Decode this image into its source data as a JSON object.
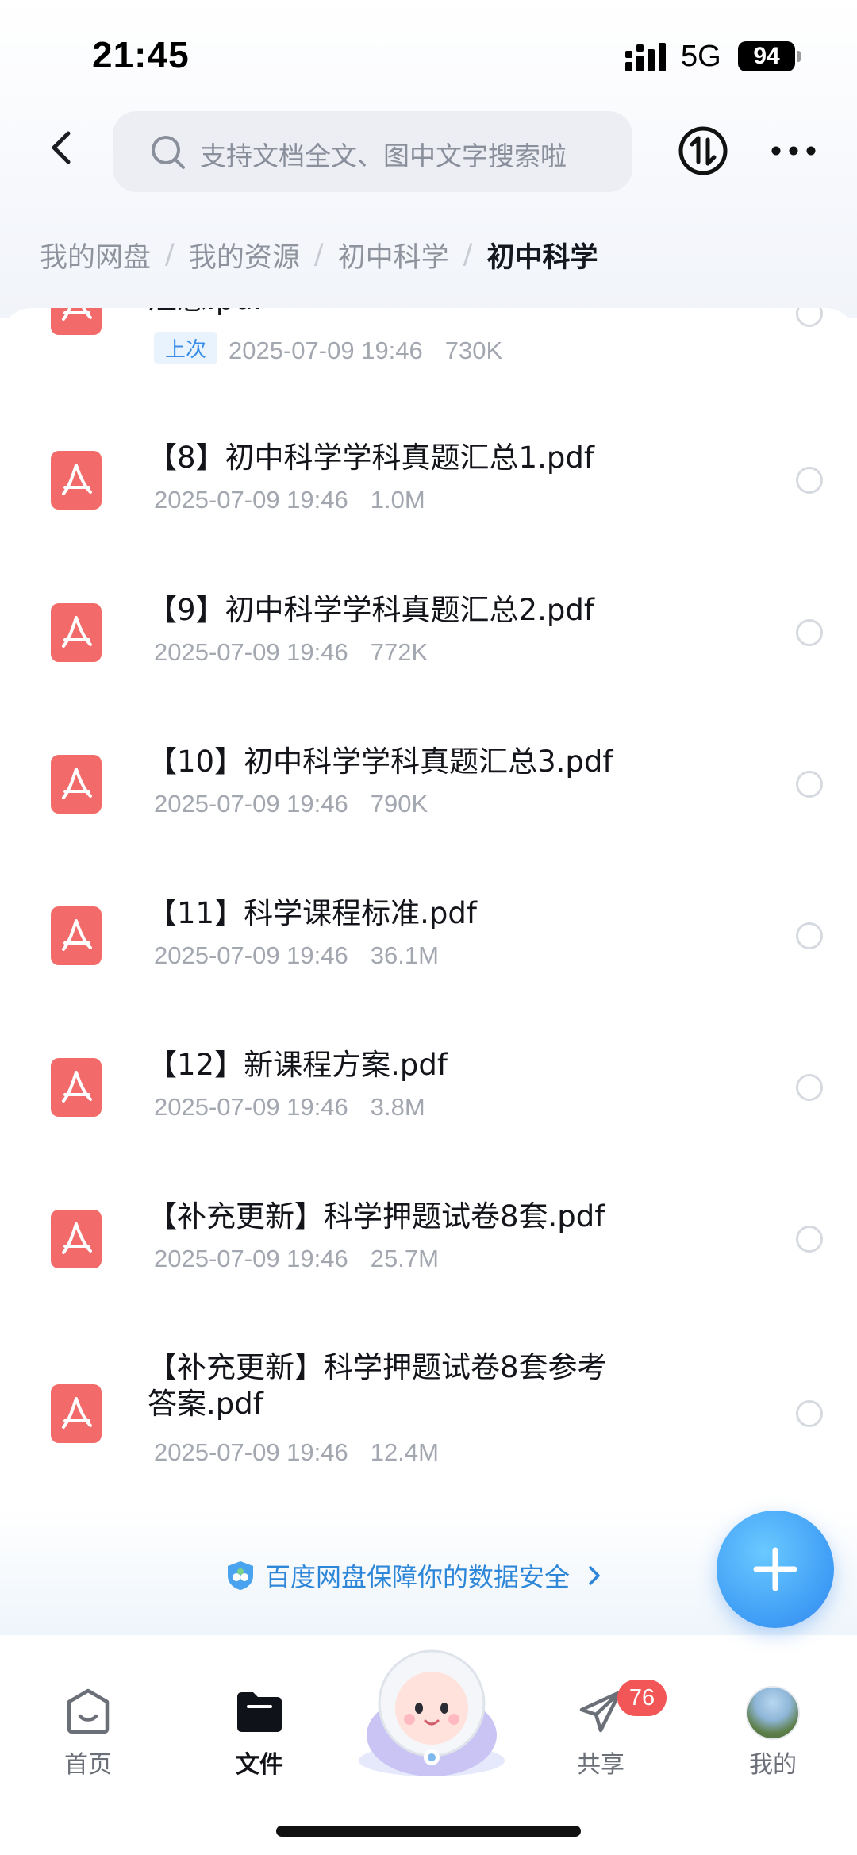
{
  "status_bar": {
    "time": "21:45",
    "network": "5G",
    "battery": "94"
  },
  "header": {
    "search_placeholder": "支持文档全文、图中文字搜索啦"
  },
  "breadcrumb": [
    "我的网盘",
    "我的资源",
    "初中科学",
    "初中科学"
  ],
  "files": [
    {
      "name": "汇总.pdf",
      "tag": "上次",
      "date": "2025-07-09 19:46",
      "size": "730K"
    },
    {
      "name": "【8】初中科学学科真题汇总1.pdf",
      "date": "2025-07-09 19:46",
      "size": "1.0M"
    },
    {
      "name": "【9】初中科学学科真题汇总2.pdf",
      "date": "2025-07-09 19:46",
      "size": "772K"
    },
    {
      "name": "【10】初中科学学科真题汇总3.pdf",
      "date": "2025-07-09 19:46",
      "size": "790K"
    },
    {
      "name": "【11】科学课程标准.pdf",
      "date": "2025-07-09 19:46",
      "size": "36.1M"
    },
    {
      "name": "【12】新课程方案.pdf",
      "date": "2025-07-09 19:46",
      "size": "3.8M"
    },
    {
      "name": "【补充更新】科学押题试卷8套.pdf",
      "date": "2025-07-09 19:46",
      "size": "25.7M"
    },
    {
      "name": "【补充更新】科学押题试卷8套参考答案.pdf",
      "date": "2025-07-09 19:46",
      "size": "12.4M"
    }
  ],
  "safety_banner": "百度网盘保障你的数据安全",
  "tabs": [
    {
      "label": "首页"
    },
    {
      "label": "文件"
    },
    {
      "label": "共享",
      "badge": "76"
    },
    {
      "label": "我的"
    }
  ],
  "colors": {
    "accent": "#3e9cf5",
    "pdf": "#f26a6a",
    "badge": "#f35656"
  }
}
